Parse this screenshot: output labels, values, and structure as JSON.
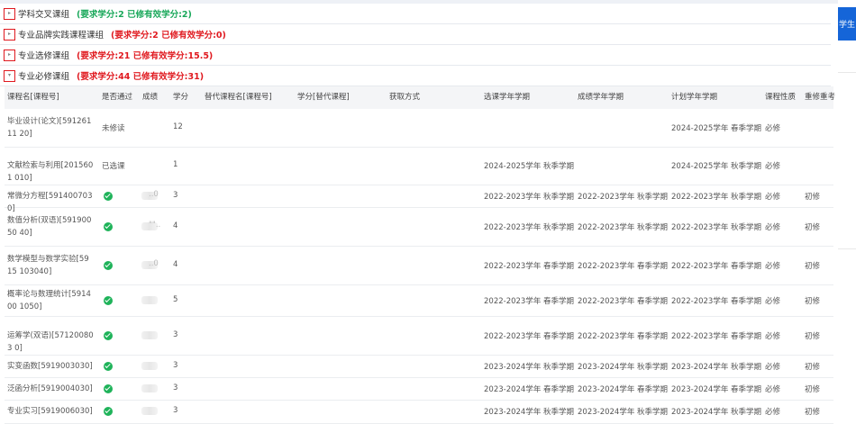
{
  "groups": [
    {
      "title": "学科交叉课组",
      "req": "(要求学分:2 已修有效学分:2)",
      "color": "green",
      "toggle": "▸"
    },
    {
      "title": "专业品牌实践课程课组",
      "req": "(要求学分:2 已修有效学分:0)",
      "color": "red",
      "toggle": "▸"
    },
    {
      "title": "专业选修课组",
      "req": "(要求学分:21 已修有效学分:15.5)",
      "color": "red",
      "toggle": "▸"
    },
    {
      "title": "专业必修课组",
      "req": "(要求学分:44 已修有效学分:31)",
      "color": "red",
      "toggle": "▾"
    }
  ],
  "side_button": "学生",
  "columns": [
    "课程名[课程号]",
    "是否通过",
    "成绩",
    "学分",
    "替代课程名[课程号]",
    "学分[替代课程]",
    "获取方式",
    "选课学年学期",
    "成绩学年学期",
    "计划学年学期",
    "课程性质",
    "重修重考"
  ],
  "rows": [
    {
      "name": "毕业设计(论文)[59126111 20]",
      "status": "未修读",
      "passed": false,
      "grade": "",
      "credit": "12",
      "sel": "",
      "score_term": "",
      "plan": "2024-2025学年 春季学期",
      "nature": "必修",
      "retake": ""
    },
    {
      "name": "文献检索与利用[2015601 010]",
      "status": "已选课",
      "passed": false,
      "grade": "",
      "credit": "1",
      "sel": "2024-2025学年 秋季学期",
      "score_term": "",
      "plan": "2024-2025学年 秋季学期",
      "nature": "必修",
      "retake": ""
    },
    {
      "name": "常微分方程[5914007030]",
      "status": "",
      "passed": true,
      "grade": "..0",
      "credit": "3",
      "sel": "2022-2023学年 秋季学期",
      "score_term": "2022-2023学年 秋季学期",
      "plan": "2022-2023学年 秋季学期",
      "nature": "必修",
      "retake": "初修"
    },
    {
      "name": "数值分析(双语)[59190050 40]",
      "status": "",
      "passed": true,
      "grade": "\"\"..",
      "credit": "4",
      "sel": "2022-2023学年 秋季学期",
      "score_term": "2022-2023学年 秋季学期",
      "plan": "2022-2023学年 秋季学期",
      "nature": "必修",
      "retake": "初修"
    },
    {
      "name": "数学模型与数学实验[5915 103040]",
      "status": "",
      "passed": true,
      "grade": "..0",
      "credit": "4",
      "sel": "2022-2023学年 春季学期",
      "score_term": "2022-2023学年 春季学期",
      "plan": "2022-2023学年 春季学期",
      "nature": "必修",
      "retake": "初修"
    },
    {
      "name": "概率论与数理统计[591400 1050]",
      "status": "",
      "passed": true,
      "grade": "",
      "credit": "5",
      "sel": "2022-2023学年 春季学期",
      "score_term": "2022-2023学年 春季学期",
      "plan": "2022-2023学年 春季学期",
      "nature": "必修",
      "retake": "初修"
    },
    {
      "name": "运筹学(双语)[571200803 0]",
      "status": "",
      "passed": true,
      "grade": "",
      "credit": "3",
      "sel": "2022-2023学年 春季学期",
      "score_term": "2022-2023学年 春季学期",
      "plan": "2022-2023学年 春季学期",
      "nature": "必修",
      "retake": "初修"
    },
    {
      "name": "实变函数[5919003030]",
      "status": "",
      "passed": true,
      "grade": "",
      "credit": "3",
      "sel": "2023-2024学年 秋季学期",
      "score_term": "2023-2024学年 秋季学期",
      "plan": "2023-2024学年 秋季学期",
      "nature": "必修",
      "retake": "初修"
    },
    {
      "name": "泛函分析[5919004030]",
      "status": "",
      "passed": true,
      "grade": "",
      "credit": "3",
      "sel": "2023-2024学年 春季学期",
      "score_term": "2023-2024学年 春季学期",
      "plan": "2023-2024学年 春季学期",
      "nature": "必修",
      "retake": "初修"
    },
    {
      "name": "专业实习[5919006030]",
      "status": "",
      "passed": true,
      "grade": "",
      "credit": "3",
      "sel": "2023-2024学年 秋季学期",
      "score_term": "2023-2024学年 秋季学期",
      "plan": "2023-2024学年 秋季学期",
      "nature": "必修",
      "retake": "初修"
    }
  ]
}
